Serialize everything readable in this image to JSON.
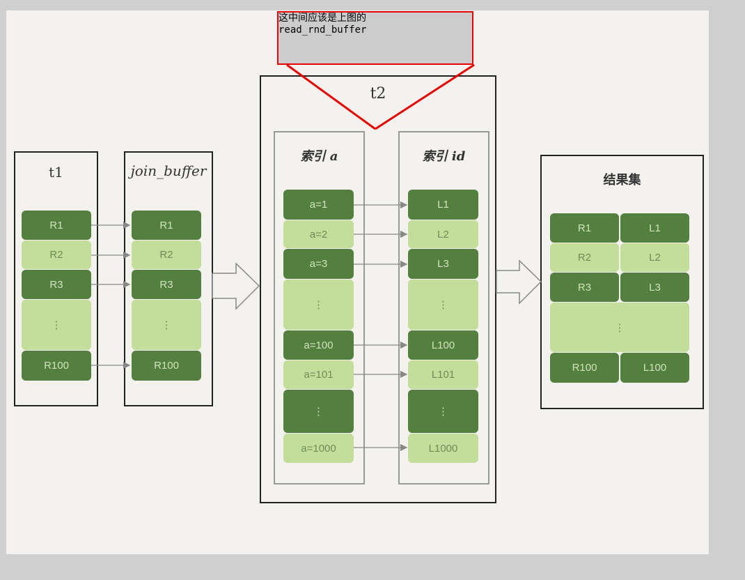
{
  "note": {
    "line1": "这中间应该是上图的",
    "line2": "read_rnd_buffer"
  },
  "t1": {
    "title": "t1",
    "rows": [
      "R1",
      "R2",
      "R3",
      "⋮",
      "R100"
    ]
  },
  "join_buffer": {
    "title": "join_buffer",
    "rows": [
      "R1",
      "R2",
      "R3",
      "⋮",
      "R100"
    ]
  },
  "t2": {
    "title": "t2",
    "index_a": {
      "title": "索引 a",
      "rows": [
        "a=1",
        "a=2",
        "a=3",
        "⋮",
        "a=100",
        "a=101",
        "⋮",
        "a=1000"
      ]
    },
    "index_id": {
      "title": "索引 id",
      "rows": [
        "L1",
        "L2",
        "L3",
        "⋮",
        "L100",
        "L101",
        "⋮",
        "L1000"
      ]
    }
  },
  "result": {
    "title": "结果集",
    "rows": [
      [
        "R1",
        "L1"
      ],
      [
        "R2",
        "L2"
      ],
      [
        "R3",
        "L3"
      ],
      [
        "⋮",
        ""
      ],
      [
        "R100",
        "L100"
      ]
    ]
  },
  "colors": {
    "dark_green": "#54803f",
    "light_green": "#c3dd9a",
    "annotation_red": "#e60000"
  }
}
